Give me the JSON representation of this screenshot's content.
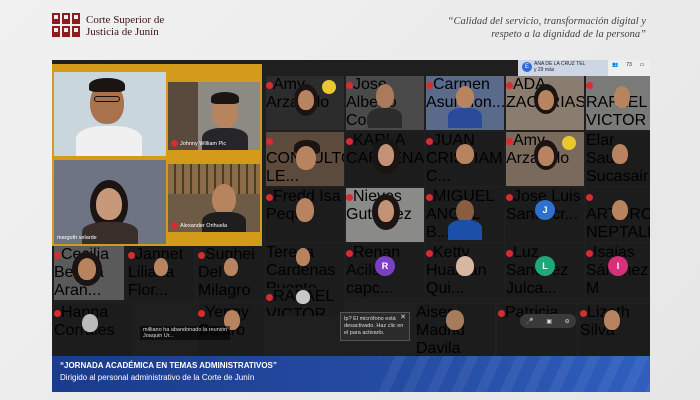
{
  "header": {
    "org_line1": "Corte Superior de",
    "org_line2": "Justicia de Junín",
    "motto_line1": "“Calidad del servicio, transformación digital y",
    "motto_line2": "respeto a la dignidad de la persona”"
  },
  "meeting": {
    "topbar_text_line1": "ANA DE LA CRUZ TEL",
    "topbar_text_line2": "y 29 más",
    "topbar_count": "73",
    "featured": [
      {
        "name": ""
      },
      {
        "name": "Johnny William Pic"
      },
      {
        "name": "margoth velarde"
      },
      {
        "name": "Alexander Orihuela"
      }
    ],
    "grid": [
      {
        "name": "Amy Arzapalo"
      },
      {
        "name": "Jose Alberto Corte..."
      },
      {
        "name": "Carmen Asuncion..."
      },
      {
        "name": "ADA ZACARIAS"
      },
      {
        "name": "RAFAEL VICTOR"
      },
      {
        "name": "CONSULTORES LE..."
      },
      {
        "name": "KARLA CARDENA..."
      },
      {
        "name": "JUAN CRISTIAM C..."
      },
      {
        "name": "Amy Arzapalo"
      },
      {
        "name": "Elar Saul Sucasair"
      },
      {
        "name": "Fredd Isa Pequ"
      },
      {
        "name": "Nieves Gutierrez"
      },
      {
        "name": "MIGUEL ANGEL B..."
      },
      {
        "name": "Jose Luis Santa cr..."
      },
      {
        "name": "ARTURO NEPTALI"
      },
      {
        "name": "Teresa Cardenas Puente"
      },
      {
        "name": "Renan Acilari capc..."
      },
      {
        "name": "Ketty Huaman Qui..."
      },
      {
        "name": "Luz Sanchez Julca..."
      },
      {
        "name": "Isaias Sánchez M"
      },
      {
        "name": "Cecilia Bethsa Aran..."
      },
      {
        "name": "Jannet Liliana Flor..."
      },
      {
        "name": "Sughei Del Milagro"
      },
      {
        "name": "RAFAEL VICTOR DAVILA..."
      },
      {
        "name": "Hanna Corrales"
      },
      {
        "name": "Aiser Madrid Davila"
      },
      {
        "name": "Patricia"
      },
      {
        "name": "Lizeth Silva"
      },
      {
        "name": "Yenny Castro"
      }
    ],
    "avatars": [
      {
        "letter": "J",
        "color": "#2f6fd0"
      },
      {
        "letter": "R",
        "color": "#7b3fc4"
      },
      {
        "letter": "L",
        "color": "#1ea77a"
      },
      {
        "letter": "I",
        "color": "#d6307a"
      }
    ],
    "leave_notice": "milliano ha abandonado la reunión",
    "leave_notice2": "Joaquin Ur...",
    "tooltip_text": "Ip? El micrófono está desactivado. Haz clic en el para activarlo.",
    "tooltip_close": "✕",
    "controls_icons": [
      "mic-icon",
      "video-icon",
      "end-icon"
    ]
  },
  "banner": {
    "title": "“JORNADA ACADÉMICA EN TEMAS ADMINISTRATIVOS”",
    "subtitle": "Dirigido al personal administrativo de la Corte de Junín"
  }
}
